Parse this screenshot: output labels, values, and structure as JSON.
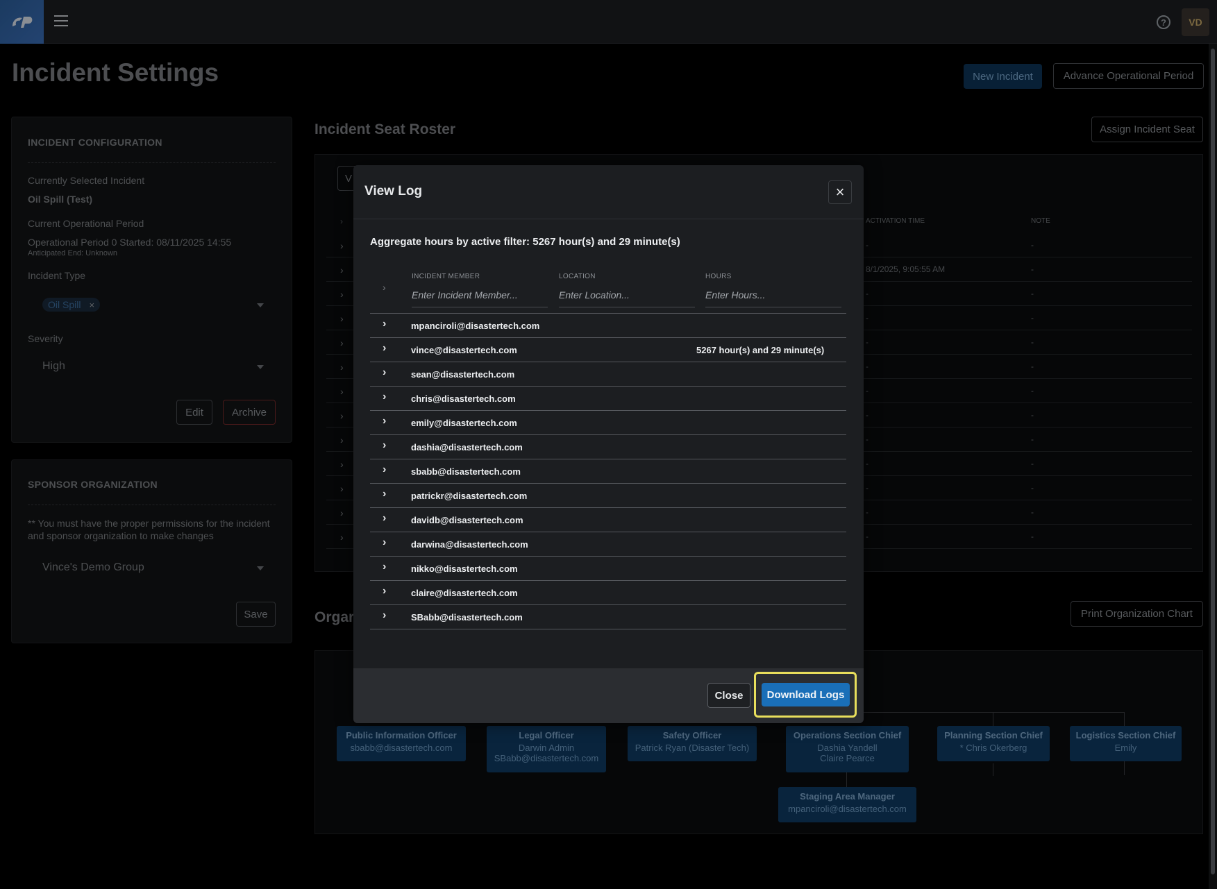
{
  "topbar": {
    "avatar": "VD",
    "help": "?"
  },
  "page": {
    "title": "Incident Settings",
    "new_incident": "New Incident",
    "advance_period": "Advance Operational Period"
  },
  "config": {
    "header": "INCIDENT CONFIGURATION",
    "selected_label": "Currently Selected Incident",
    "selected_value": "Oil Spill (Test)",
    "period_label": "Current Operational Period",
    "period_value": "Operational Period 0 Started: 08/11/2025 14:55",
    "anticipated": "Anticipated End: Unknown",
    "type_label": "Incident Type",
    "type_chip": "Oil Spill",
    "chip_remove": "×",
    "severity_label": "Severity",
    "severity_value": "High",
    "edit": "Edit",
    "archive": "Archive"
  },
  "sponsor": {
    "header": "SPONSOR ORGANIZATION",
    "note": "** You must have the proper permissions for the incident and sponsor organization to make changes",
    "org": "Vince's Demo Group",
    "save": "Save"
  },
  "roster": {
    "title": "Incident Seat Roster",
    "assign": "Assign Incident Seat",
    "col_activation": "ACTIVATION TIME",
    "col_note": "NOTE",
    "tab_fragment": "V",
    "rows": [
      {
        "act": "-",
        "note": "-"
      },
      {
        "act": "8/1/2025, 9:05:55 AM",
        "note": "-"
      },
      {
        "act": "-",
        "note": "-"
      },
      {
        "act": "-",
        "note": "-"
      },
      {
        "act": "-",
        "note": "-"
      },
      {
        "act": "-",
        "note": "-"
      },
      {
        "act": "-",
        "note": "-"
      },
      {
        "act": "-",
        "note": "-"
      },
      {
        "act": "-",
        "note": "-"
      },
      {
        "act": "-",
        "note": "-"
      },
      {
        "act": "-",
        "note": "-"
      },
      {
        "act": "-",
        "note": "-"
      },
      {
        "act": "-",
        "note": "-"
      }
    ]
  },
  "org": {
    "title_fragment": "Orgar",
    "print": "Print Organization Chart",
    "boxes": [
      {
        "title": "Public Information Officer",
        "lines": [
          "sbabb@disastertech.com"
        ]
      },
      {
        "title": "Legal Officer",
        "lines": [
          "Darwin Admin",
          "SBabb@disastertech.com"
        ]
      },
      {
        "title": "Safety Officer",
        "lines": [
          "Patrick Ryan (Disaster Tech)"
        ]
      },
      {
        "title": "Operations Section Chief",
        "lines": [
          "Dashia Yandell",
          "Claire Pearce"
        ]
      },
      {
        "title": "Planning Section Chief",
        "lines": [
          "* Chris Okerberg"
        ]
      },
      {
        "title": "Logistics Section Chief",
        "lines": [
          "Emily"
        ]
      },
      {
        "title": "Staging Area Manager",
        "lines": [
          "mpanciroli@disastertech.com"
        ]
      }
    ]
  },
  "modal": {
    "title": "View Log",
    "close_x": "×",
    "aggregate": "Aggregate hours by active filter: 5267 hour(s) and 29 minute(s)",
    "col_member": "INCIDENT MEMBER",
    "col_location": "LOCATION",
    "col_hours": "HOURS",
    "ph_member": "Enter Incident Member...",
    "ph_location": "Enter Location...",
    "ph_hours": "Enter Hours...",
    "rows": [
      {
        "email": "mpanciroli@disastertech.com",
        "hours": ""
      },
      {
        "email": "vince@disastertech.com",
        "hours": "5267 hour(s) and 29 minute(s)"
      },
      {
        "email": "sean@disastertech.com",
        "hours": ""
      },
      {
        "email": "chris@disastertech.com",
        "hours": ""
      },
      {
        "email": "emily@disastertech.com",
        "hours": ""
      },
      {
        "email": "dashia@disastertech.com",
        "hours": ""
      },
      {
        "email": "sbabb@disastertech.com",
        "hours": ""
      },
      {
        "email": "patrickr@disastertech.com",
        "hours": ""
      },
      {
        "email": "davidb@disastertech.com",
        "hours": ""
      },
      {
        "email": "darwina@disastertech.com",
        "hours": ""
      },
      {
        "email": "nikko@disastertech.com",
        "hours": ""
      },
      {
        "email": "claire@disastertech.com",
        "hours": ""
      },
      {
        "email": "SBabb@disastertech.com",
        "hours": ""
      }
    ],
    "close": "Close",
    "download": "Download Logs"
  }
}
